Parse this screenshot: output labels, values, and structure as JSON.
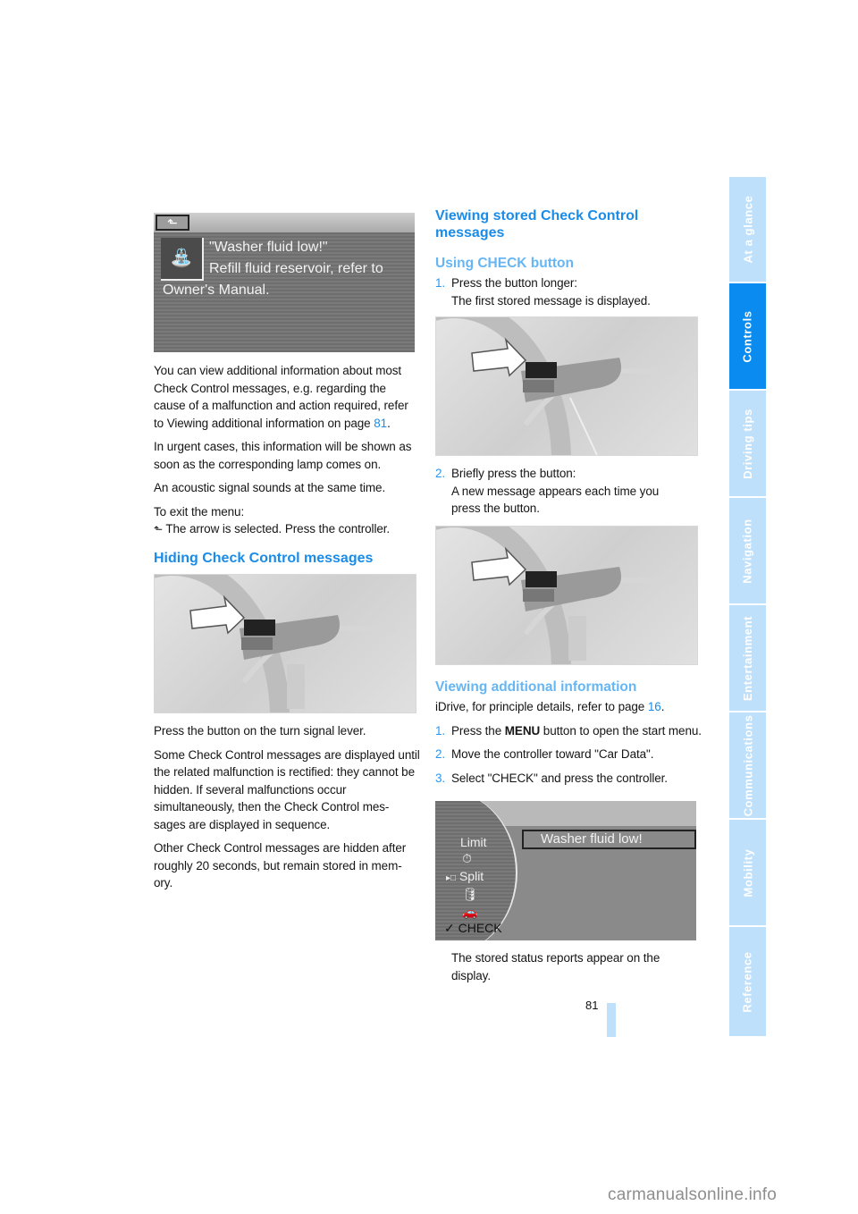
{
  "page": {
    "number": "81",
    "footer_watermark": "carmanualsonline.info"
  },
  "side_tabs": [
    {
      "label": "At a glance",
      "active": false
    },
    {
      "label": "Controls",
      "active": true
    },
    {
      "label": "Driving tips",
      "active": false
    },
    {
      "label": "Navigation",
      "active": false
    },
    {
      "label": "Entertainment",
      "active": false
    },
    {
      "label": "Communications",
      "active": false
    },
    {
      "label": "Mobility",
      "active": false
    },
    {
      "label": "Reference",
      "active": false
    }
  ],
  "colors": {
    "heading": "#1a8ce8",
    "subheading": "#66b6f4",
    "tab_active": "#0a8bef",
    "tab_inactive": "#bfe0fb"
  },
  "left": {
    "screen1": {
      "back_icon": "back-arrow-icon",
      "warning_icon": "washer-fluid-icon",
      "title": "\"Washer fluid low!\"",
      "line2": "Refill fluid reservoir, refer to",
      "line3": "Owner's Manual."
    },
    "p1_text": "You can view additional information about most Check Control messages, e.g. regarding the cause of a malfunction and action required, refer to Viewing additional information on page ",
    "p1_link": "81",
    "p1_end": ".",
    "p2": "In urgent cases, this information will be shown as soon as the corresponding lamp comes on.",
    "p3": "An acoustic signal sounds at the same time.",
    "p4_line1": "To exit the menu:",
    "p4_line2": "The arrow is selected. Press the controller.",
    "hiding_heading": "Hiding Check Control messages",
    "p5": "Press the button on the turn signal lever.",
    "p6": "Some Check Control messages are displayed until the related malfunction is rectified: they cannot be hidden. If several malfunctions occur simultaneously, then the Check Control mes-sages are displayed in sequence.",
    "p7": "Other Check Control messages are hidden after roughly 20 seconds, but remain stored in mem-ory."
  },
  "right": {
    "heading": "Viewing stored Check Control messages",
    "sub1": "Using CHECK button",
    "steps1": [
      {
        "n": "1.",
        "line1": "Press the button longer:",
        "line2": "The first stored message is displayed."
      },
      {
        "n": "2.",
        "line1": "Briefly press the button:",
        "line2": "A new message appears each time you press the button."
      }
    ],
    "sub2": "Viewing additional information",
    "intro_text": "iDrive, for principle details, refer to page ",
    "intro_link": "16",
    "intro_end": ".",
    "steps2": [
      {
        "n": "1.",
        "pre": "Press the ",
        "kbd": "MENU",
        "post": " button to open the start menu."
      },
      {
        "n": "2.",
        "text": "Move the controller toward \"Car Data\"."
      },
      {
        "n": "3.",
        "text": "Select \"CHECK\" and press the controller."
      }
    ],
    "screen2": {
      "menu": [
        "Limit",
        "",
        "Split",
        "",
        "",
        "CHECK"
      ],
      "selected": "CHECK",
      "message": "Washer fluid low!"
    },
    "closing": "The stored status reports appear on the display."
  }
}
